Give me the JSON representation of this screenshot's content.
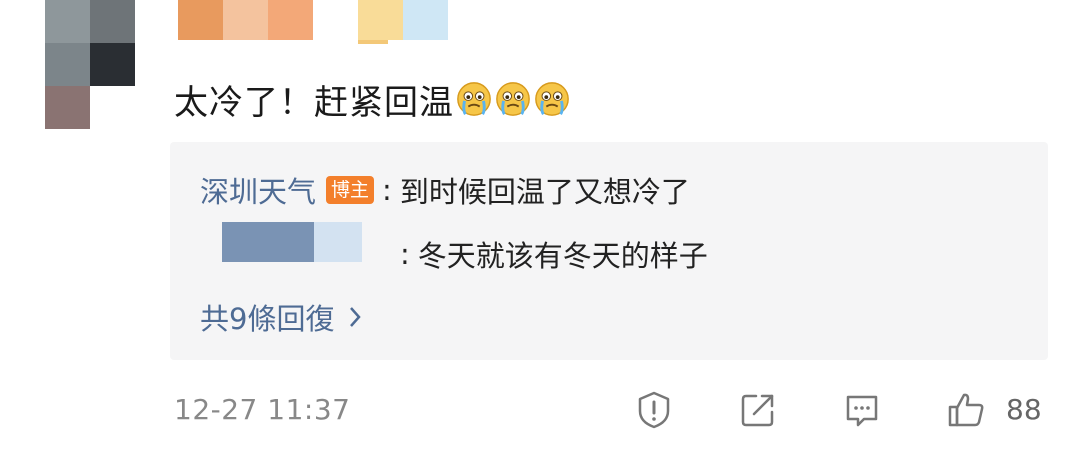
{
  "comment": {
    "text": "太冷了！赶紧回温",
    "emoji_count": 3,
    "emoji_name": "crying-face-emoji"
  },
  "replies": [
    {
      "author": "深圳天气",
      "badge": "博主",
      "separator": ":",
      "text": "到时候回温了又想冷了"
    },
    {
      "author": "",
      "separator": ":",
      "text": "冬天就该有冬天的样子"
    }
  ],
  "more_replies": {
    "label": "共9條回復",
    "icon": "chevron-right-icon"
  },
  "footer": {
    "time": "12-27 11:37",
    "icons": [
      "report-icon",
      "repost-icon",
      "comment-icon",
      "like-icon"
    ],
    "like_count": "88"
  },
  "colors": {
    "link": "#4e6b94",
    "badge": "#f37f2b",
    "box_bg": "#f5f5f6",
    "muted": "#888888"
  }
}
